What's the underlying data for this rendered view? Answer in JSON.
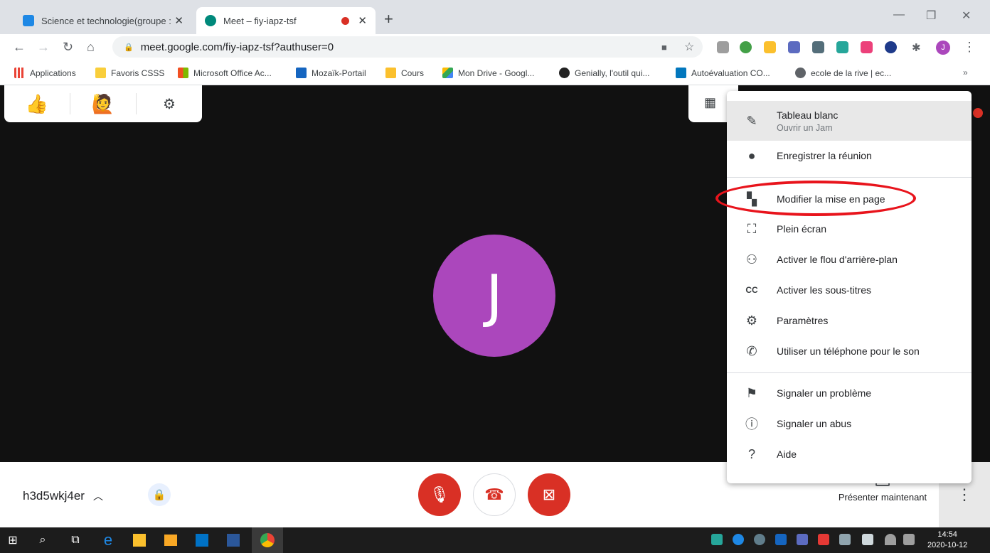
{
  "browser": {
    "tabs": [
      {
        "title": "Science et technologie(groupe :",
        "close": "✕"
      },
      {
        "title": "Meet – fiy-iapz-tsf",
        "close": "✕"
      }
    ],
    "new_tab": "+",
    "url": "meet.google.com/fiy-iapz-tsf?authuser=0",
    "profile_initial": "J",
    "bookmarks": [
      "Applications",
      "Favoris CSSS",
      "Microsoft Office Ac...",
      "Mozaïk-Portail",
      "Cours",
      "Mon Drive - Googl...",
      "Genially, l'outil qui...",
      "Autoévaluation CO...",
      "ecole de la rive | ec..."
    ],
    "bookmarks_overflow": "»"
  },
  "meet": {
    "participant_initial": "J",
    "meeting_code": "h3d5wkj4er",
    "present_label": "Présenter maintenant",
    "more_options": "⋮"
  },
  "menu": {
    "items": [
      {
        "label": "Tableau blanc",
        "sub": "Ouvrir un Jam",
        "icon": "pen-icon"
      },
      {
        "label": "Enregistrer la réunion",
        "icon": "record-icon"
      },
      {
        "label": "Modifier la mise en page",
        "icon": "layout-icon"
      },
      {
        "label": "Plein écran",
        "icon": "fullscreen-icon"
      },
      {
        "label": "Activer le flou d'arrière-plan",
        "icon": "blur-icon"
      },
      {
        "label": "Activer les sous-titres",
        "icon": "captions-icon"
      },
      {
        "label": "Paramètres",
        "icon": "gear-icon"
      },
      {
        "label": "Utiliser un téléphone pour le son",
        "icon": "phone-icon"
      },
      {
        "label": "Signaler un problème",
        "icon": "feedback-icon"
      },
      {
        "label": "Signaler un abus",
        "icon": "warning-icon"
      },
      {
        "label": "Aide",
        "icon": "help-icon"
      }
    ]
  },
  "taskbar": {
    "time": "14:54",
    "date": "2020-10-12"
  },
  "colors": {
    "accent_red": "#d93025",
    "avatar_purple": "#ab47bc",
    "highlight_red": "#e8141c"
  }
}
